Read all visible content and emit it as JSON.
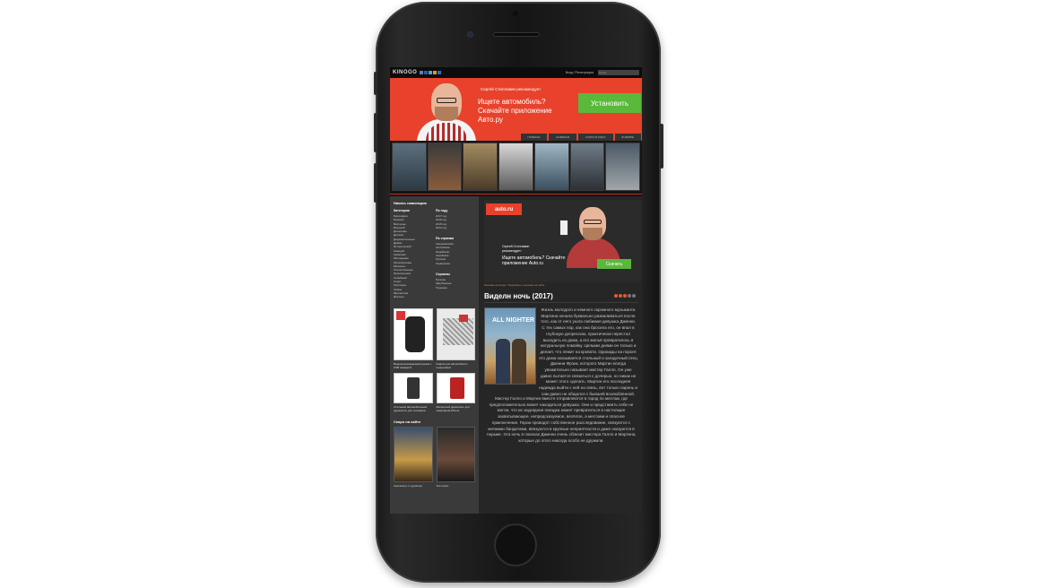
{
  "site": {
    "logo": "KINOGO",
    "login": "Вход / Регистрация",
    "search_placeholder": "Поиск"
  },
  "banner": {
    "small": "Сергей Стиллавин рекомендует",
    "main": "Ищете автомобиль? Скачайте приложение Авто.ру",
    "button": "Установить"
  },
  "menu": [
    "ГЛАВНАЯ",
    "НОВИНКИ",
    "СКОРО В КИНО",
    "В ЭФИРЕ"
  ],
  "sidebar": {
    "title": "Начать навигацию",
    "categories_title": "Категории",
    "categories": [
      "Биография",
      "Боевики",
      "Вестерны",
      "Военный",
      "Детективы",
      "Детские",
      "Документальные",
      "Драмы",
      "Исторический",
      "Комедии",
      "Криминал",
      "Мелодрамы",
      "Мультфильмы",
      "Мюзиклы",
      "Отечественные",
      "Приключения",
      "Семейный",
      "Спорт",
      "Триллеры",
      "Ужасы",
      "Фантастика",
      "Фэнтези"
    ],
    "years_title": "По году",
    "years": [
      "2017 год",
      "2016 год",
      "2015 год",
      "2014 год"
    ],
    "countries_title": "По странам",
    "countries": [
      "Американские",
      "Английские",
      "Индийские",
      "Корейские",
      "Русские",
      "Украинские"
    ],
    "serials_title": "Сериалы",
    "serials": [
      "Русские",
      "Зарубежные",
      "Турецкие"
    ],
    "products": [
      {
        "caption": "Водонепроницаемый рюкзак с USB зарядкой"
      },
      {
        "caption": "Коврик для автомобиля с подогревом"
      },
      {
        "caption": "Стильный автомобильный держатель для телефона"
      },
      {
        "caption": "Магнитный держатель для смартфона iPhone"
      }
    ],
    "soon_title": "Скоро на сайте",
    "soon": [
      {
        "caption": "Красавица и чудовище"
      },
      {
        "caption": "Зов крови"
      }
    ]
  },
  "main": {
    "ad": {
      "logo": "auto.ru",
      "small": "Сергей Стиллавин рекомендует:",
      "main": "Ищете автомобиль? Скачайте приложение Auto.ru",
      "button": "Скачать"
    },
    "ad_caption": "Реклама на kinogo • Подробнее о рекламе на сайте",
    "movie_title": "Виделн ночь (2017)",
    "rating": 3,
    "rating_max": 5,
    "description_1": "Жизнь молодого и немного скромного музыканта Мартина начала буквально разваливаться после того, как от него ушла любимая девушка Джинни. С тех самых пор, как она бросила его, он впал в глубокую депрессию, практически перестал выходить из дома, а его жильё превратилось в натуральную помойку. Целыми днями он только и делает, что лежит на кровати. Однажды на пороге его дома оказывается стильный и загадочный отец Джинни Фрэнк, которого Мартин всегда уважительно называет мистер Галло. Он уже давно пытается связаться с дочерью, но никак не может этого сделать. Мартин его последняя надежда выйти с ней на связь, вот только парень и сам давно не общался с бывшей возлюбленной.",
    "description_2": "Мистер Галло и Мартин вместе отправляются в город по местам, где предположительно может находиться девушка. Они и представить себе не могли, что их заурядная поездка может превратиться в настоящее захватывающее, непредсказуемое, весёлое, а местами и опасное приключение. Герои проводят собственное расследование, связуются с мелкими бандитами, ввязуются в крупные неприятности и даже оказуются в тюрьме. Эта ночь в поисках Джинни очень сблизит мистера Галло и Мартина, которые до этого никогда особо не дружили."
  },
  "poster_title": "ALL NIGHTER",
  "colors": {
    "accent": "#e8422c",
    "button_green": "#5ab83a"
  }
}
